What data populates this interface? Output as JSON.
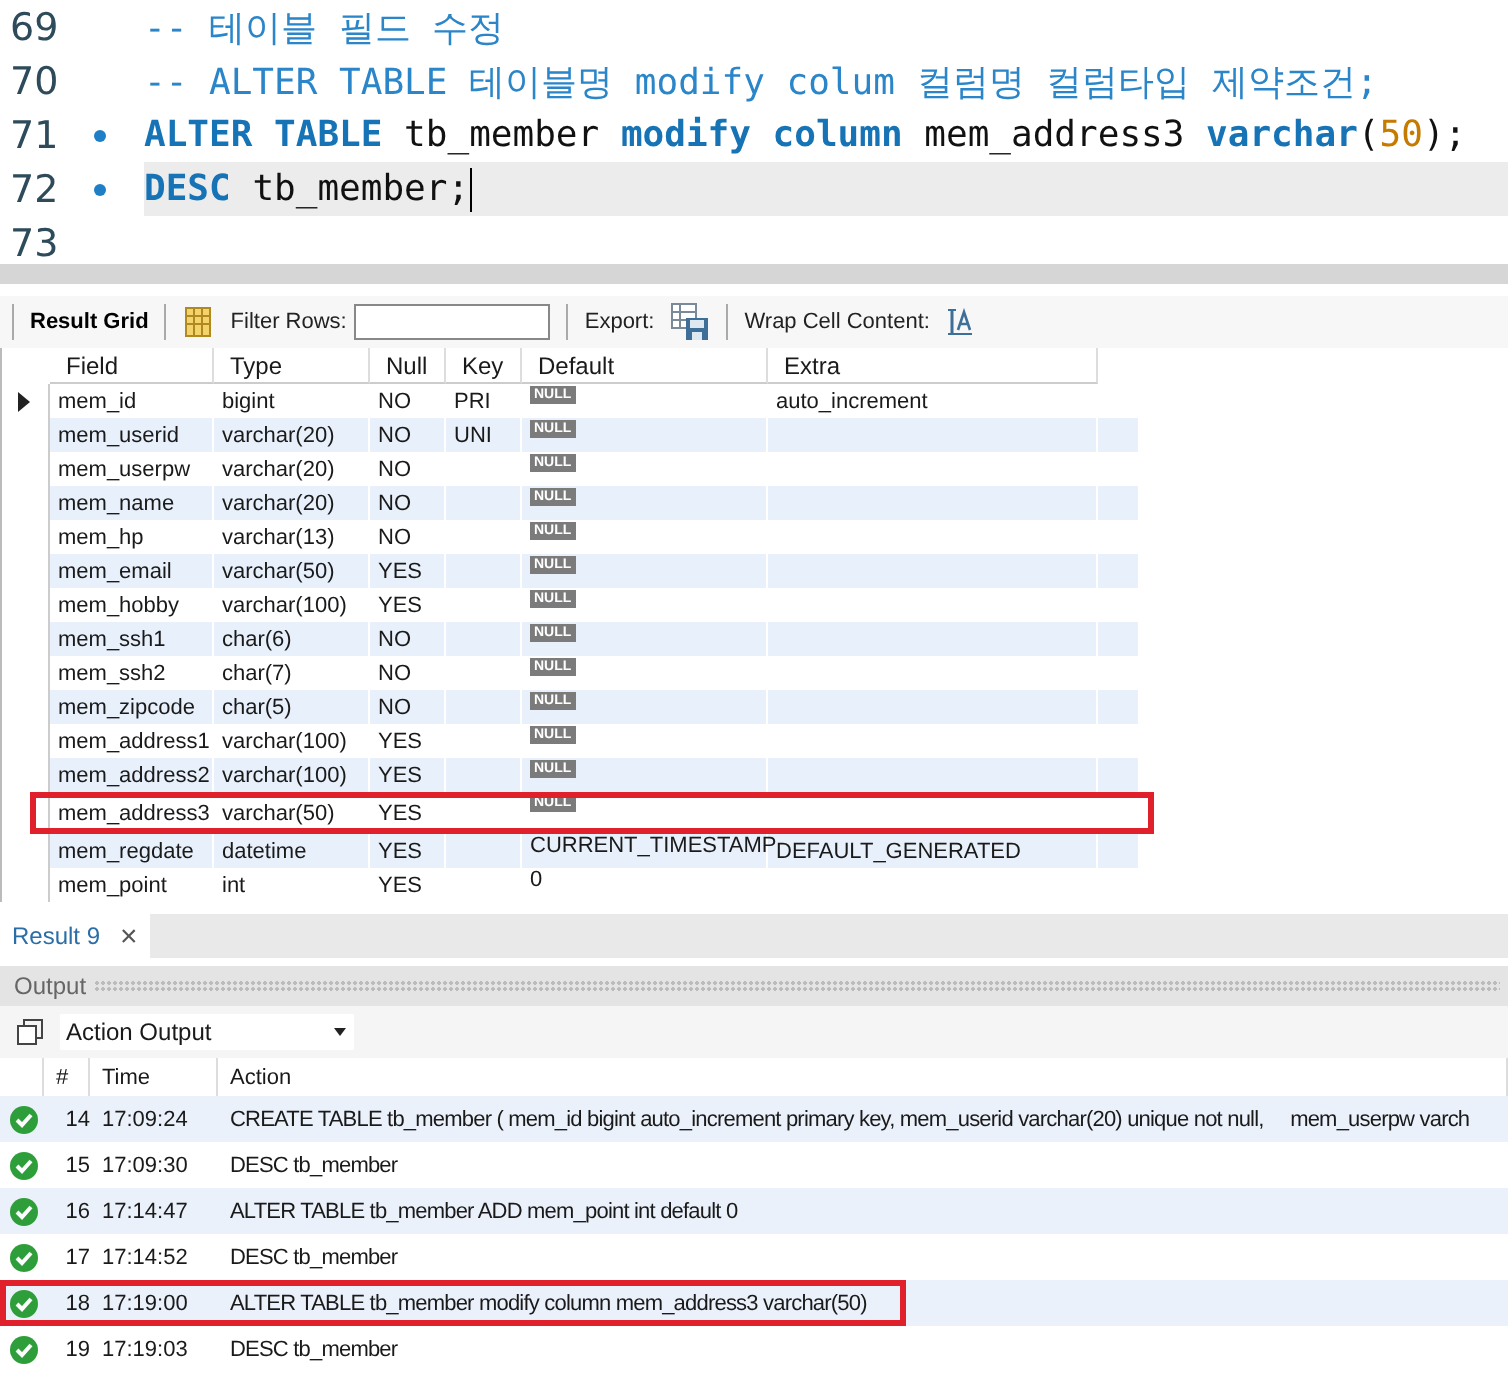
{
  "editor": {
    "lines": [
      {
        "number": "69",
        "marker": false,
        "current": false,
        "tokens": [
          {
            "kind": "comment",
            "text": "-- 테이블 필드 수정"
          }
        ]
      },
      {
        "number": "70",
        "marker": false,
        "current": false,
        "tokens": [
          {
            "kind": "comment",
            "text": "-- ALTER TABLE 테이블명 modify colum 컬럼명 컬럼타입 제약조건;"
          }
        ]
      },
      {
        "number": "71",
        "marker": true,
        "current": false,
        "tokens": [
          {
            "kind": "keyword",
            "text": "ALTER TABLE"
          },
          {
            "kind": "plain",
            "text": " tb_member "
          },
          {
            "kind": "keyword",
            "text": "modify column"
          },
          {
            "kind": "plain",
            "text": " mem_address3 "
          },
          {
            "kind": "keyword",
            "text": "varchar"
          },
          {
            "kind": "plain",
            "text": "("
          },
          {
            "kind": "number",
            "text": "50"
          },
          {
            "kind": "plain",
            "text": ");"
          }
        ]
      },
      {
        "number": "72",
        "marker": true,
        "current": true,
        "tokens": [
          {
            "kind": "keyword",
            "text": "DESC"
          },
          {
            "kind": "plain",
            "text": " tb_member;"
          }
        ]
      },
      {
        "number": "73",
        "marker": false,
        "current": false
      }
    ]
  },
  "toolbar": {
    "result_grid": "Result Grid",
    "filter_label": "Filter Rows:",
    "export_label": "Export:",
    "wrap_label": "Wrap Cell Content:"
  },
  "grid": {
    "columns": [
      "Field",
      "Type",
      "Null",
      "Key",
      "Default",
      "Extra"
    ],
    "rows": [
      {
        "selected": true,
        "highlighted": false,
        "cells": [
          "mem_id",
          "bigint",
          "NO",
          "PRI",
          "NULL",
          "auto_increment"
        ],
        "default_null": true
      },
      {
        "selected": false,
        "highlighted": false,
        "cells": [
          "mem_userid",
          "varchar(20)",
          "NO",
          "UNI",
          "NULL",
          ""
        ],
        "default_null": true
      },
      {
        "selected": false,
        "highlighted": false,
        "cells": [
          "mem_userpw",
          "varchar(20)",
          "NO",
          "",
          "NULL",
          ""
        ],
        "default_null": true
      },
      {
        "selected": false,
        "highlighted": false,
        "cells": [
          "mem_name",
          "varchar(20)",
          "NO",
          "",
          "NULL",
          ""
        ],
        "default_null": true
      },
      {
        "selected": false,
        "highlighted": false,
        "cells": [
          "mem_hp",
          "varchar(13)",
          "NO",
          "",
          "NULL",
          ""
        ],
        "default_null": true
      },
      {
        "selected": false,
        "highlighted": false,
        "cells": [
          "mem_email",
          "varchar(50)",
          "YES",
          "",
          "NULL",
          ""
        ],
        "default_null": true
      },
      {
        "selected": false,
        "highlighted": false,
        "cells": [
          "mem_hobby",
          "varchar(100)",
          "YES",
          "",
          "NULL",
          ""
        ],
        "default_null": true
      },
      {
        "selected": false,
        "highlighted": false,
        "cells": [
          "mem_ssh1",
          "char(6)",
          "NO",
          "",
          "NULL",
          ""
        ],
        "default_null": true
      },
      {
        "selected": false,
        "highlighted": false,
        "cells": [
          "mem_ssh2",
          "char(7)",
          "NO",
          "",
          "NULL",
          ""
        ],
        "default_null": true
      },
      {
        "selected": false,
        "highlighted": false,
        "cells": [
          "mem_zipcode",
          "char(5)",
          "NO",
          "",
          "NULL",
          ""
        ],
        "default_null": true
      },
      {
        "selected": false,
        "highlighted": false,
        "cells": [
          "mem_address1",
          "varchar(100)",
          "YES",
          "",
          "NULL",
          ""
        ],
        "default_null": true
      },
      {
        "selected": false,
        "highlighted": false,
        "cells": [
          "mem_address2",
          "varchar(100)",
          "YES",
          "",
          "NULL",
          ""
        ],
        "default_null": true
      },
      {
        "selected": false,
        "highlighted": true,
        "cells": [
          "mem_address3",
          "varchar(50)",
          "YES",
          "",
          "NULL",
          ""
        ],
        "default_null": true
      },
      {
        "selected": false,
        "highlighted": false,
        "cells": [
          "mem_regdate",
          "datetime",
          "YES",
          "",
          "CURRENT_TIMESTAMP",
          "DEFAULT_GENERATED"
        ],
        "default_null": false
      },
      {
        "selected": false,
        "highlighted": false,
        "cells": [
          "mem_point",
          "int",
          "YES",
          "",
          "0",
          ""
        ],
        "default_null": false
      }
    ]
  },
  "result_tab": {
    "label": "Result 9",
    "close": "×"
  },
  "output": {
    "title": "Output",
    "dropdown": "Action Output",
    "columns": [
      "#",
      "Time",
      "Action"
    ],
    "rows": [
      {
        "kind": "success",
        "highlighted": false,
        "number": "14",
        "time": "17:09:24",
        "action": "CREATE TABLE tb_member ( mem_id bigint auto_increment primary key, mem_userid varchar(20) unique not null,     mem_userpw varch"
      },
      {
        "kind": "success",
        "highlighted": false,
        "number": "15",
        "time": "17:09:30",
        "action": "DESC tb_member"
      },
      {
        "kind": "success",
        "highlighted": false,
        "number": "16",
        "time": "17:14:47",
        "action": "ALTER TABLE tb_member ADD mem_point int default 0"
      },
      {
        "kind": "success",
        "highlighted": false,
        "number": "17",
        "time": "17:14:52",
        "action": "DESC tb_member"
      },
      {
        "kind": "success",
        "highlighted": true,
        "number": "18",
        "time": "17:19:00",
        "action": "ALTER TABLE tb_member modify column mem_address3 varchar(50)"
      },
      {
        "kind": "success",
        "highlighted": false,
        "number": "19",
        "time": "17:19:03",
        "action": "DESC tb_member"
      }
    ]
  }
}
